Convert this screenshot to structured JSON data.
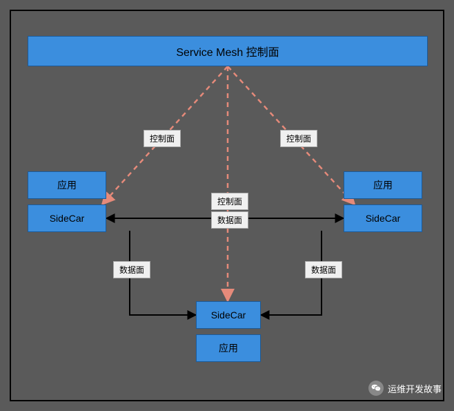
{
  "diagram": {
    "control_plane": "Service Mesh 控制面",
    "app_left": "应用",
    "sidecar_left": "SideCar",
    "app_right": "应用",
    "sidecar_right": "SideCar",
    "sidecar_bottom": "SideCar",
    "app_bottom": "应用"
  },
  "edge_labels": {
    "ctrl_left": "控制面",
    "ctrl_mid": "控制面",
    "ctrl_right": "控制面",
    "data_top": "数据面",
    "data_left": "数据面",
    "data_right": "数据面"
  },
  "watermark": {
    "text": "运维开发故事"
  },
  "chart_data": {
    "type": "diagram",
    "title": "Service Mesh 控制面",
    "nodes": [
      {
        "id": "control_plane",
        "label": "Service Mesh 控制面",
        "role": "control-plane"
      },
      {
        "id": "app_left",
        "label": "应用",
        "role": "application"
      },
      {
        "id": "sidecar_left",
        "label": "SideCar",
        "role": "sidecar"
      },
      {
        "id": "app_right",
        "label": "应用",
        "role": "application"
      },
      {
        "id": "sidecar_right",
        "label": "SideCar",
        "role": "sidecar"
      },
      {
        "id": "sidecar_bottom",
        "label": "SideCar",
        "role": "sidecar"
      },
      {
        "id": "app_bottom",
        "label": "应用",
        "role": "application"
      }
    ],
    "edges": [
      {
        "from": "control_plane",
        "to": "sidecar_left",
        "type": "control-plane",
        "label": "控制面",
        "style": "dashed"
      },
      {
        "from": "control_plane",
        "to": "sidecar_bottom",
        "type": "control-plane",
        "label": "控制面",
        "style": "dashed"
      },
      {
        "from": "control_plane",
        "to": "sidecar_right",
        "type": "control-plane",
        "label": "控制面",
        "style": "dashed"
      },
      {
        "from": "sidecar_left",
        "to": "sidecar_right",
        "type": "data-plane",
        "label": "数据面",
        "style": "solid",
        "bidirectional": true
      },
      {
        "from": "sidecar_left",
        "to": "sidecar_bottom",
        "type": "data-plane",
        "label": "数据面",
        "style": "solid"
      },
      {
        "from": "sidecar_right",
        "to": "sidecar_bottom",
        "type": "data-plane",
        "label": "数据面",
        "style": "solid"
      }
    ],
    "legend": {
      "控制面": "control-plane traffic (dashed, red)",
      "数据面": "data-plane traffic (solid, black)"
    }
  }
}
